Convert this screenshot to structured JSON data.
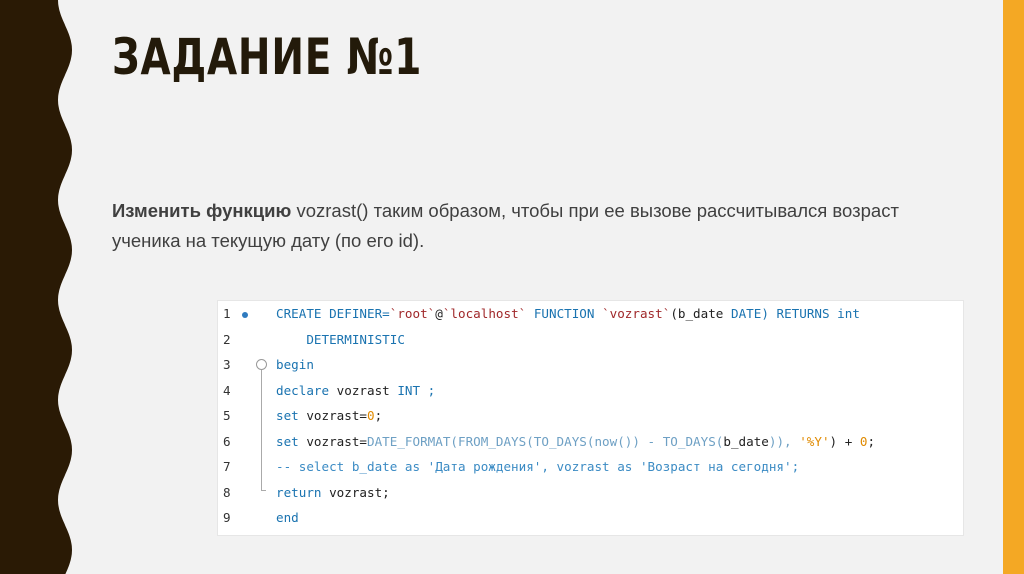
{
  "slide": {
    "title": "ЗАДАНИЕ №1",
    "description_bold": "Изменить функцию",
    "description_fn": "vozrast",
    "description_rest": "() таким образом, чтобы при ее вызове рассчитывался возраст ученика на текущую дату (по его id).",
    "colors": {
      "left_band": "#2a1a05",
      "right_bar": "#f4a824",
      "background": "#f2f2f2"
    }
  },
  "code": {
    "line_numbers": [
      "1",
      "2",
      "3",
      "4",
      "5",
      "6",
      "7",
      "8",
      "9"
    ],
    "l1": {
      "a": "CREATE DEFINER=",
      "b": "`root`",
      "c": "@",
      "d": "`localhost`",
      "e": " FUNCTION ",
      "f": "`vozrast`",
      "g": "(b_date ",
      "h": "DATE",
      "i": ") RETURNS int"
    },
    "l2": "    DETERMINISTIC",
    "l3": "begin",
    "l4": {
      "a": "declare",
      "b": " vozrast ",
      "c": "INT ;"
    },
    "l5": {
      "a": "set",
      "b": " vozrast=",
      "c": "0",
      "d": ";"
    },
    "l6": {
      "a": "set",
      "b": " vozrast=",
      "c": "DATE_FORMAT(FROM_DAYS(TO_DAYS(now()) - TO_DAYS(",
      "d": "b_date",
      "e": ")), ",
      "f": "'%Y'",
      "g": ") + ",
      "h": "0",
      "i": ";"
    },
    "l7": "-- select b_date as 'Дата рождения', vozrast as 'Возраст на сегодня';",
    "l8": {
      "a": "return",
      "b": " vozrast;"
    },
    "l9": "end"
  }
}
